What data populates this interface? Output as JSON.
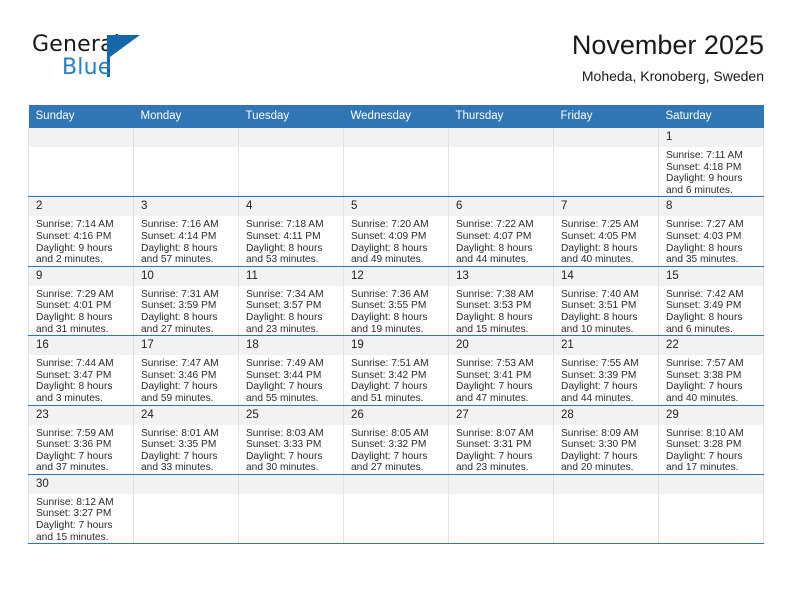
{
  "brand": {
    "name_top": "General",
    "name_bottom": "Blue",
    "accent_color": "#2580c3",
    "triangle_color": "#1567a8"
  },
  "header": {
    "title": "November 2025",
    "location": "Moheda, Kronoberg, Sweden"
  },
  "theme": {
    "header_bg": "#3075b4",
    "header_text": "#ffffff",
    "daynum_bg": "#f2f2f2",
    "cell_border": "#e2e2e2"
  },
  "weekdays": [
    "Sunday",
    "Monday",
    "Tuesday",
    "Wednesday",
    "Thursday",
    "Friday",
    "Saturday"
  ],
  "weeks": [
    [
      {
        "day": "",
        "empty": true
      },
      {
        "day": "",
        "empty": true
      },
      {
        "day": "",
        "empty": true
      },
      {
        "day": "",
        "empty": true
      },
      {
        "day": "",
        "empty": true
      },
      {
        "day": "",
        "empty": true
      },
      {
        "day": "1",
        "sunrise": "Sunrise: 7:11 AM",
        "sunset": "Sunset: 4:18 PM",
        "daylight1": "Daylight: 9 hours",
        "daylight2": "and 6 minutes."
      }
    ],
    [
      {
        "day": "2",
        "sunrise": "Sunrise: 7:14 AM",
        "sunset": "Sunset: 4:16 PM",
        "daylight1": "Daylight: 9 hours",
        "daylight2": "and 2 minutes."
      },
      {
        "day": "3",
        "sunrise": "Sunrise: 7:16 AM",
        "sunset": "Sunset: 4:14 PM",
        "daylight1": "Daylight: 8 hours",
        "daylight2": "and 57 minutes."
      },
      {
        "day": "4",
        "sunrise": "Sunrise: 7:18 AM",
        "sunset": "Sunset: 4:11 PM",
        "daylight1": "Daylight: 8 hours",
        "daylight2": "and 53 minutes."
      },
      {
        "day": "5",
        "sunrise": "Sunrise: 7:20 AM",
        "sunset": "Sunset: 4:09 PM",
        "daylight1": "Daylight: 8 hours",
        "daylight2": "and 49 minutes."
      },
      {
        "day": "6",
        "sunrise": "Sunrise: 7:22 AM",
        "sunset": "Sunset: 4:07 PM",
        "daylight1": "Daylight: 8 hours",
        "daylight2": "and 44 minutes."
      },
      {
        "day": "7",
        "sunrise": "Sunrise: 7:25 AM",
        "sunset": "Sunset: 4:05 PM",
        "daylight1": "Daylight: 8 hours",
        "daylight2": "and 40 minutes."
      },
      {
        "day": "8",
        "sunrise": "Sunrise: 7:27 AM",
        "sunset": "Sunset: 4:03 PM",
        "daylight1": "Daylight: 8 hours",
        "daylight2": "and 35 minutes."
      }
    ],
    [
      {
        "day": "9",
        "sunrise": "Sunrise: 7:29 AM",
        "sunset": "Sunset: 4:01 PM",
        "daylight1": "Daylight: 8 hours",
        "daylight2": "and 31 minutes."
      },
      {
        "day": "10",
        "sunrise": "Sunrise: 7:31 AM",
        "sunset": "Sunset: 3:59 PM",
        "daylight1": "Daylight: 8 hours",
        "daylight2": "and 27 minutes."
      },
      {
        "day": "11",
        "sunrise": "Sunrise: 7:34 AM",
        "sunset": "Sunset: 3:57 PM",
        "daylight1": "Daylight: 8 hours",
        "daylight2": "and 23 minutes."
      },
      {
        "day": "12",
        "sunrise": "Sunrise: 7:36 AM",
        "sunset": "Sunset: 3:55 PM",
        "daylight1": "Daylight: 8 hours",
        "daylight2": "and 19 minutes."
      },
      {
        "day": "13",
        "sunrise": "Sunrise: 7:38 AM",
        "sunset": "Sunset: 3:53 PM",
        "daylight1": "Daylight: 8 hours",
        "daylight2": "and 15 minutes."
      },
      {
        "day": "14",
        "sunrise": "Sunrise: 7:40 AM",
        "sunset": "Sunset: 3:51 PM",
        "daylight1": "Daylight: 8 hours",
        "daylight2": "and 10 minutes."
      },
      {
        "day": "15",
        "sunrise": "Sunrise: 7:42 AM",
        "sunset": "Sunset: 3:49 PM",
        "daylight1": "Daylight: 8 hours",
        "daylight2": "and 6 minutes."
      }
    ],
    [
      {
        "day": "16",
        "sunrise": "Sunrise: 7:44 AM",
        "sunset": "Sunset: 3:47 PM",
        "daylight1": "Daylight: 8 hours",
        "daylight2": "and 3 minutes."
      },
      {
        "day": "17",
        "sunrise": "Sunrise: 7:47 AM",
        "sunset": "Sunset: 3:46 PM",
        "daylight1": "Daylight: 7 hours",
        "daylight2": "and 59 minutes."
      },
      {
        "day": "18",
        "sunrise": "Sunrise: 7:49 AM",
        "sunset": "Sunset: 3:44 PM",
        "daylight1": "Daylight: 7 hours",
        "daylight2": "and 55 minutes."
      },
      {
        "day": "19",
        "sunrise": "Sunrise: 7:51 AM",
        "sunset": "Sunset: 3:42 PM",
        "daylight1": "Daylight: 7 hours",
        "daylight2": "and 51 minutes."
      },
      {
        "day": "20",
        "sunrise": "Sunrise: 7:53 AM",
        "sunset": "Sunset: 3:41 PM",
        "daylight1": "Daylight: 7 hours",
        "daylight2": "and 47 minutes."
      },
      {
        "day": "21",
        "sunrise": "Sunrise: 7:55 AM",
        "sunset": "Sunset: 3:39 PM",
        "daylight1": "Daylight: 7 hours",
        "daylight2": "and 44 minutes."
      },
      {
        "day": "22",
        "sunrise": "Sunrise: 7:57 AM",
        "sunset": "Sunset: 3:38 PM",
        "daylight1": "Daylight: 7 hours",
        "daylight2": "and 40 minutes."
      }
    ],
    [
      {
        "day": "23",
        "sunrise": "Sunrise: 7:59 AM",
        "sunset": "Sunset: 3:36 PM",
        "daylight1": "Daylight: 7 hours",
        "daylight2": "and 37 minutes."
      },
      {
        "day": "24",
        "sunrise": "Sunrise: 8:01 AM",
        "sunset": "Sunset: 3:35 PM",
        "daylight1": "Daylight: 7 hours",
        "daylight2": "and 33 minutes."
      },
      {
        "day": "25",
        "sunrise": "Sunrise: 8:03 AM",
        "sunset": "Sunset: 3:33 PM",
        "daylight1": "Daylight: 7 hours",
        "daylight2": "and 30 minutes."
      },
      {
        "day": "26",
        "sunrise": "Sunrise: 8:05 AM",
        "sunset": "Sunset: 3:32 PM",
        "daylight1": "Daylight: 7 hours",
        "daylight2": "and 27 minutes."
      },
      {
        "day": "27",
        "sunrise": "Sunrise: 8:07 AM",
        "sunset": "Sunset: 3:31 PM",
        "daylight1": "Daylight: 7 hours",
        "daylight2": "and 23 minutes."
      },
      {
        "day": "28",
        "sunrise": "Sunrise: 8:09 AM",
        "sunset": "Sunset: 3:30 PM",
        "daylight1": "Daylight: 7 hours",
        "daylight2": "and 20 minutes."
      },
      {
        "day": "29",
        "sunrise": "Sunrise: 8:10 AM",
        "sunset": "Sunset: 3:28 PM",
        "daylight1": "Daylight: 7 hours",
        "daylight2": "and 17 minutes."
      }
    ],
    [
      {
        "day": "30",
        "sunrise": "Sunrise: 8:12 AM",
        "sunset": "Sunset: 3:27 PM",
        "daylight1": "Daylight: 7 hours",
        "daylight2": "and 15 minutes."
      },
      {
        "day": "",
        "empty": true
      },
      {
        "day": "",
        "empty": true
      },
      {
        "day": "",
        "empty": true
      },
      {
        "day": "",
        "empty": true
      },
      {
        "day": "",
        "empty": true
      },
      {
        "day": "",
        "empty": true
      }
    ]
  ]
}
